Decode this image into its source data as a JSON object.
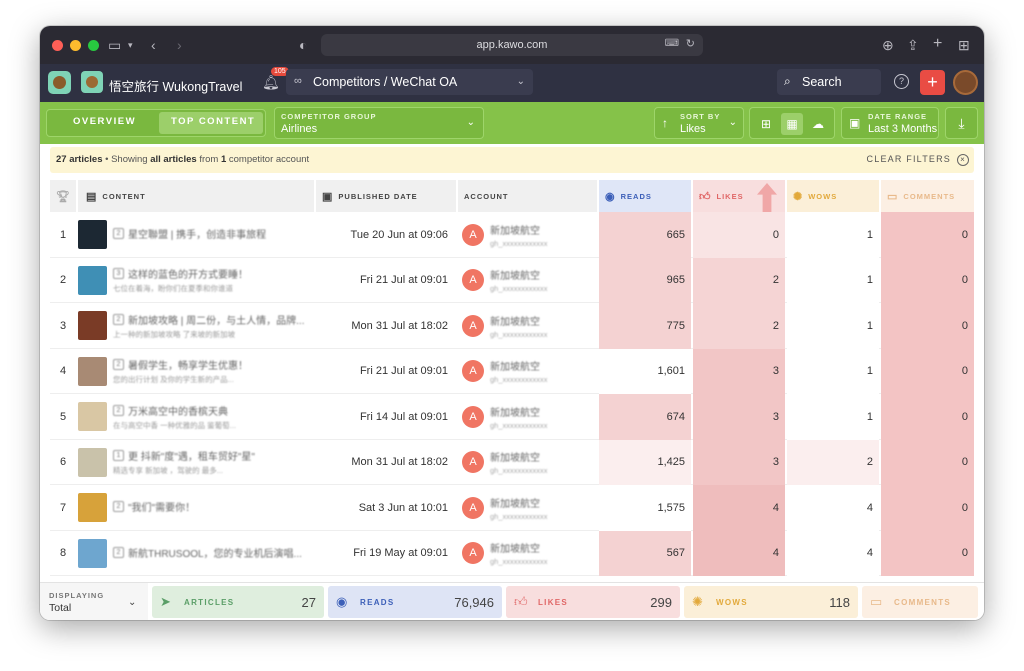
{
  "browser": {
    "url": "app.kawo.com"
  },
  "header": {
    "account_name": "悟空旅行 WukongTravel",
    "notification_count": "105",
    "breadcrumb": "Competitors / WeChat OA",
    "search_label": "Search",
    "help_glyph": "?",
    "add_glyph": "+"
  },
  "toolbar": {
    "tabs": [
      {
        "label": "OVERVIEW",
        "active": false
      },
      {
        "label": "TOP CONTENT",
        "active": true
      }
    ],
    "competitor_group": {
      "label": "COMPETITOR GROUP",
      "value": "Airlines"
    },
    "sort_by": {
      "label": "SORT BY",
      "value": "Likes"
    },
    "date_range": {
      "label": "DATE RANGE",
      "value": "Last 3 Months"
    }
  },
  "filter_bar": {
    "count": "27 articles",
    "separator": "•",
    "text_a": "Showing",
    "text_b": "all articles",
    "text_c": "from",
    "text_d": "1",
    "text_e": "competitor account",
    "clear_label": "CLEAR FILTERS",
    "clear_glyph": "×"
  },
  "table": {
    "columns": {
      "content": "CONTENT",
      "published": "PUBLISHED DATE",
      "account": "ACCOUNT",
      "reads": "READS",
      "likes": "LIKES",
      "wows": "WOWS",
      "comments": "COMMENTS"
    },
    "rows": [
      {
        "num": "1",
        "pos": "2",
        "title": "星空聯盟 | 携手，创造非事旅程",
        "subtitle": "",
        "date": "Tue 20 Jun at 09:06",
        "avatar": "A",
        "account": "新加坡航空",
        "account_id": "gh_xxxxxxxxxxxx",
        "reads": "665",
        "likes": "0",
        "wows": "1",
        "comments": "0",
        "thumb": "#1c2833"
      },
      {
        "num": "2",
        "pos": "3",
        "title": "这样的蓝色的开方式要睡！",
        "subtitle": "七位在着海，盼你们在夏季和你谁道",
        "date": "Fri 21 Jul at 09:01",
        "avatar": "A",
        "account": "新加坡航空",
        "account_id": "gh_xxxxxxxxxxxx",
        "reads": "965",
        "likes": "2",
        "wows": "1",
        "comments": "0",
        "thumb": "#3f8fb5"
      },
      {
        "num": "3",
        "pos": "2",
        "title": "新加坡攻略 | 周二份，与土人情，品牌...",
        "subtitle": "上一种的新加坡攻略 了来坡的新加坡",
        "date": "Mon 31 Jul at 18:02",
        "avatar": "A",
        "account": "新加坡航空",
        "account_id": "gh_xxxxxxxxxxxx",
        "reads": "775",
        "likes": "2",
        "wows": "1",
        "comments": "0",
        "thumb": "#7a3b26"
      },
      {
        "num": "4",
        "pos": "2",
        "title": "暑假学生，畅享学生优惠！",
        "subtitle": "您的出行计划 及你的学生新的产品...",
        "date": "Fri 21 Jul at 09:01",
        "avatar": "A",
        "account": "新加坡航空",
        "account_id": "gh_xxxxxxxxxxxx",
        "reads": "1,601",
        "likes": "3",
        "wows": "1",
        "comments": "0",
        "thumb": "#a88a74"
      },
      {
        "num": "5",
        "pos": "2",
        "title": "万米高空中的香槟天典",
        "subtitle": "在与高空中香 一种优雅的品 鉴葡萄...",
        "date": "Fri 14 Jul at 09:01",
        "avatar": "A",
        "account": "新加坡航空",
        "account_id": "gh_xxxxxxxxxxxx",
        "reads": "674",
        "likes": "3",
        "wows": "1",
        "comments": "0",
        "thumb": "#d9c7a4"
      },
      {
        "num": "6",
        "pos": "1",
        "title": "更 抖新\"度\"遇，租车贸好\"星\"",
        "subtitle": "精选专享 新加坡 ，驾驶的 最多...",
        "date": "Mon 31 Jul at 18:02",
        "avatar": "A",
        "account": "新加坡航空",
        "account_id": "gh_xxxxxxxxxxxx",
        "reads": "1,425",
        "likes": "3",
        "wows": "2",
        "comments": "0",
        "thumb": "#c9c2aa"
      },
      {
        "num": "7",
        "pos": "2",
        "title": "\"我们\"需要你！",
        "subtitle": "",
        "date": "Sat 3 Jun at 10:01",
        "avatar": "A",
        "account": "新加坡航空",
        "account_id": "gh_xxxxxxxxxxxx",
        "reads": "1,575",
        "likes": "4",
        "wows": "4",
        "comments": "0",
        "thumb": "#d7a23a"
      },
      {
        "num": "8",
        "pos": "2",
        "title": "新航THRUSOOL，您的专业机后演唱...",
        "subtitle": "",
        "date": "Fri 19 May at 09:01",
        "avatar": "A",
        "account": "新加坡航空",
        "account_id": "gh_xxxxxxxxxxxx",
        "reads": "567",
        "likes": "4",
        "wows": "4",
        "comments": "0",
        "thumb": "#6ea6cf"
      }
    ]
  },
  "footer": {
    "displaying_label": "DISPLAYING",
    "displaying_value": "Total",
    "articles": {
      "label": "ARTICLES",
      "value": "27"
    },
    "reads": {
      "label": "READS",
      "value": "76,946"
    },
    "likes": {
      "label": "LIKES",
      "value": "299"
    },
    "wows": {
      "label": "WOWS",
      "value": "118"
    },
    "comments": {
      "label": "COMMENTS",
      "value": ""
    }
  },
  "colors": {
    "toolbar_green": "#85c249",
    "reads_heat": "#f4d2d2",
    "likes_heat": "#f2c6c6",
    "comments_heat": "#f3c4c4"
  }
}
